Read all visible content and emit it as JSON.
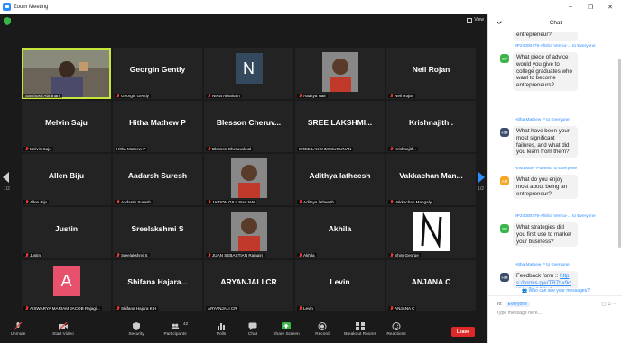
{
  "window": {
    "title": "Zoom Meeting"
  },
  "meeting": {
    "view_label": "View",
    "page_left": "1/2",
    "page_right": "1/2",
    "tiles": [
      {
        "type": "video",
        "label": "Santhosh Abraham",
        "active": true,
        "muted": false
      },
      {
        "type": "name",
        "big": "Georgin Gently",
        "label": "Georgin Gently",
        "muted": true
      },
      {
        "type": "letter",
        "letter": "N",
        "color": "#34495e",
        "label": "Neha Abraham",
        "muted": true
      },
      {
        "type": "image",
        "label": "Aaditya Nair",
        "muted": true
      },
      {
        "type": "name",
        "big": "Neil Rojan",
        "label": "Neil Rojan",
        "muted": true
      },
      {
        "type": "name",
        "big": "Melvin Saju",
        "label": "Melvin Saju",
        "muted": true
      },
      {
        "type": "name",
        "big": "Hitha Mathew P",
        "label": "Hitha Mathew P",
        "muted": false
      },
      {
        "type": "name",
        "big": "Blesson Cheruv...",
        "label": "Blesson Cheruvakkal",
        "muted": true
      },
      {
        "type": "name",
        "big": "SREE LAKSHMI...",
        "label": "SREE LAKSHMI SUGUNAN",
        "muted": false
      },
      {
        "type": "name",
        "big": "Krishnajith .",
        "label": "Krishnajith .",
        "muted": true
      },
      {
        "type": "name",
        "big": "Allen Biju",
        "label": "Allen Biju",
        "muted": true
      },
      {
        "type": "name",
        "big": "Aadarsh Suresh",
        "label": "Aadarsh Suresh",
        "muted": true
      },
      {
        "type": "image",
        "label": "JAIDON GILL SHAJAN",
        "muted": true
      },
      {
        "type": "name",
        "big": "Adithya latheesh",
        "label": "Adithya latheesh",
        "muted": true
      },
      {
        "type": "name",
        "big": "Vakkachan Man...",
        "label": "Vakkachan Mangaly",
        "muted": true
      },
      {
        "type": "name",
        "big": "Justin",
        "label": "Justin",
        "muted": true
      },
      {
        "type": "name",
        "big": "Sreelakshmi S",
        "label": "Sreelakshmi S",
        "muted": true
      },
      {
        "type": "image",
        "label": "JUAN SEBASTIAN Rajagiri",
        "muted": true
      },
      {
        "type": "name",
        "big": "Akhila",
        "label": "Akhila",
        "muted": true
      },
      {
        "type": "image-n",
        "label": "Shini George",
        "muted": true
      },
      {
        "type": "letter",
        "letter": "A",
        "color": "#e8516b",
        "label": "AISWARYA MARIAM JACOB Rajagi...",
        "muted": true
      },
      {
        "type": "name",
        "big": "Shifana Hajara...",
        "label": "Shifana Hajara K.H",
        "muted": true
      },
      {
        "type": "name",
        "big": "ARYANJALI CR",
        "label": "ARYANJALI CR",
        "muted": false
      },
      {
        "type": "name",
        "big": "Levin",
        "label": "Levin",
        "muted": true
      },
      {
        "type": "name",
        "big": "ANJANA C",
        "label": "ANJANA C",
        "muted": true
      }
    ]
  },
  "toolbar": {
    "unmute": "Unmute",
    "start_video": "Start Video",
    "security": "Security",
    "participants": "Participants",
    "participants_count": "42",
    "polls": "Polls",
    "chat": "Chat",
    "share_screen": "Share Screen",
    "record": "Record",
    "breakout": "Breakout Rooms",
    "reactions": "Reactions",
    "leave": "Leave"
  },
  "chat": {
    "title": "Chat",
    "messages": [
      {
        "from": "",
        "to": "",
        "avatar": "",
        "color": "",
        "text": "entrepreneur?"
      },
      {
        "from": "9P24000476-Alisha Verma-...",
        "to": "to Everyone",
        "avatar": "9V",
        "color": "#3ab54a",
        "text": "What piece of advice would you give to college graduates who want to become entrepreneurs?"
      },
      {
        "from": "Hitha Mathew P",
        "to": "to Everyone",
        "avatar": "HM",
        "color": "#3a4a6b",
        "text": "What have been your most significant failures, and what did you learn from them?"
      },
      {
        "from": "Ansu Mary Puthettu",
        "to": "to Everyone",
        "avatar": "AM",
        "color": "#f5a623",
        "text": "What do you enjoy most about being an entrepreneur?"
      },
      {
        "from": "9P24000476-Alisha Verma-...",
        "to": "to Everyone",
        "avatar": "9V",
        "color": "#3ab54a",
        "text": "What strategies did you first use to market your business?"
      },
      {
        "from": "Hitha Mathew P",
        "to": "to Everyone",
        "avatar": "HM",
        "color": "#3a4a6b",
        "text": "Feedback form ::",
        "link": "https://forms.gle/TR7Lx9cKXmDn2Q2h6"
      }
    ],
    "who_can_see": "Who can see your messages?",
    "to_label": "To:",
    "to_value": "Everyone",
    "placeholder": "Type message here..."
  }
}
